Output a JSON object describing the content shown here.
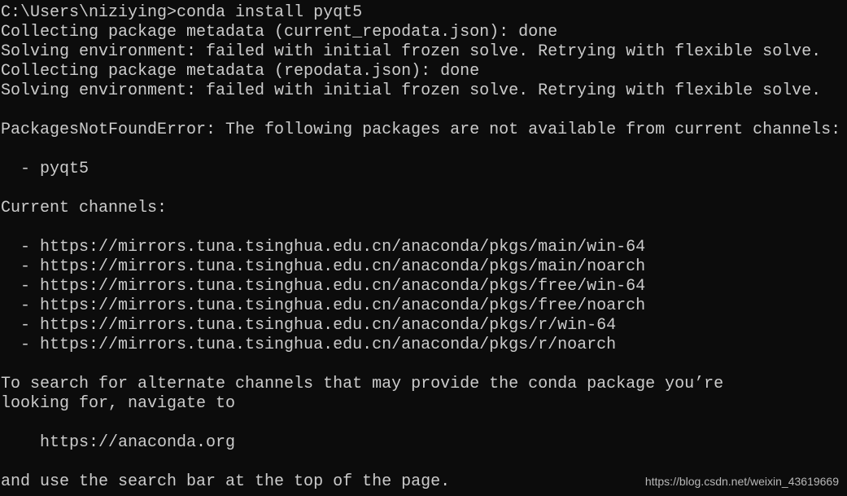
{
  "terminal": {
    "lines": [
      "C:\\Users\\niziying>conda install pyqt5",
      "Collecting package metadata (current_repodata.json): done",
      "Solving environment: failed with initial frozen solve. Retrying with flexible solve.",
      "Collecting package metadata (repodata.json): done",
      "Solving environment: failed with initial frozen solve. Retrying with flexible solve.",
      "",
      "PackagesNotFoundError: The following packages are not available from current channels:",
      "",
      "  - pyqt5",
      "",
      "Current channels:",
      "",
      "  - https://mirrors.tuna.tsinghua.edu.cn/anaconda/pkgs/main/win-64",
      "  - https://mirrors.tuna.tsinghua.edu.cn/anaconda/pkgs/main/noarch",
      "  - https://mirrors.tuna.tsinghua.edu.cn/anaconda/pkgs/free/win-64",
      "  - https://mirrors.tuna.tsinghua.edu.cn/anaconda/pkgs/free/noarch",
      "  - https://mirrors.tuna.tsinghua.edu.cn/anaconda/pkgs/r/win-64",
      "  - https://mirrors.tuna.tsinghua.edu.cn/anaconda/pkgs/r/noarch",
      "",
      "To search for alternate channels that may provide the conda package you’re",
      "looking for, navigate to",
      "",
      "    https://anaconda.org",
      "",
      "and use the search bar at the top of the page."
    ]
  },
  "watermark": "https://blog.csdn.net/weixin_43619669",
  "colors": {
    "background": "#0c0c0c",
    "text": "#cccccc"
  }
}
